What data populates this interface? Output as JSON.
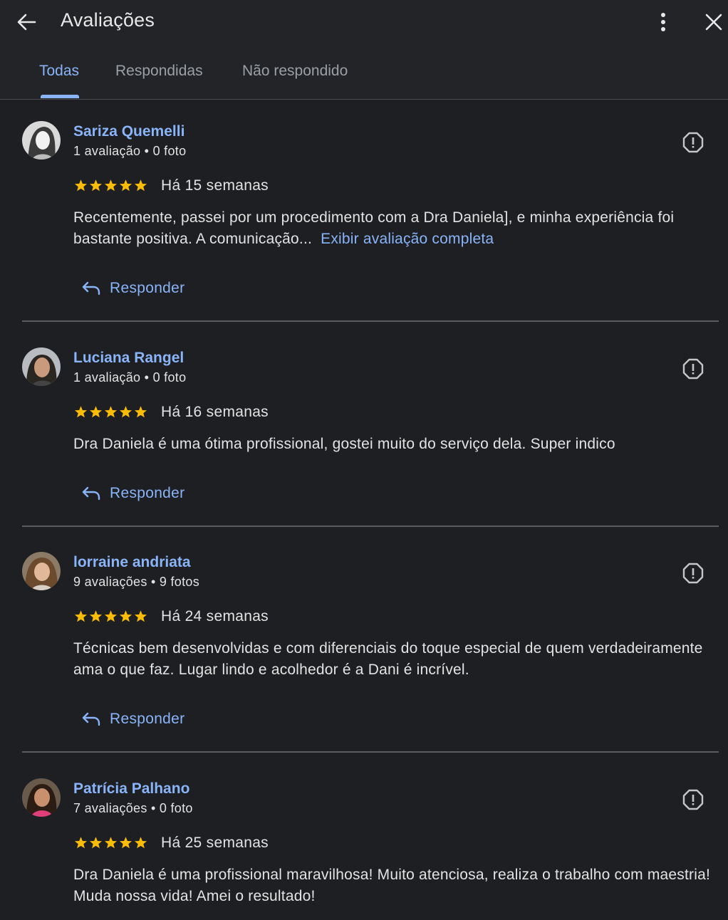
{
  "header": {
    "title": "Avaliações",
    "back_icon": "arrow-back-icon",
    "more_icon": "more-vert-icon",
    "close_icon": "close-icon"
  },
  "tabs": [
    {
      "label": "Todas",
      "active": true
    },
    {
      "label": "Respondidas",
      "active": false
    },
    {
      "label": "Não respondido",
      "active": false
    }
  ],
  "colors": {
    "background": "#1e1f23",
    "accent": "#8ab4f8",
    "star": "#fbbc04",
    "text": "#e3e3e3"
  },
  "reviews": [
    {
      "name": "Sariza Quemelli",
      "meta": "1 avaliação • 0 foto",
      "rating": 5,
      "when": "Há 15 semanas",
      "text": "Recentemente, passei por um procedimento com a Dra Daniela], e minha experiência foi bastante positiva. A comunicação...",
      "more_link": "Exibir avaliação completa",
      "reply_label": "Responder"
    },
    {
      "name": "Luciana Rangel",
      "meta": "1 avaliação • 0 foto",
      "rating": 5,
      "when": "Há 16 semanas",
      "text": "Dra Daniela é uma ótima profissional, gostei muito do serviço dela. Super indico",
      "reply_label": "Responder"
    },
    {
      "name": "lorraine andriata",
      "meta": "9 avaliações • 9 fotos",
      "rating": 5,
      "when": "Há 24 semanas",
      "text": "Técnicas bem desenvolvidas e com diferenciais do toque especial de quem verdadeiramente ama o que faz. Lugar lindo e acolhedor é a Dani é incrível.",
      "reply_label": "Responder"
    },
    {
      "name": "Patrícia Palhano",
      "meta": "7 avaliações • 0 foto",
      "rating": 5,
      "when": "Há 25 semanas",
      "text": "Dra Daniela é uma profissional maravilhosa! Muito atenciosa, realiza o trabalho com maestria! Muda nossa vida! Amei o resultado!"
    }
  ]
}
